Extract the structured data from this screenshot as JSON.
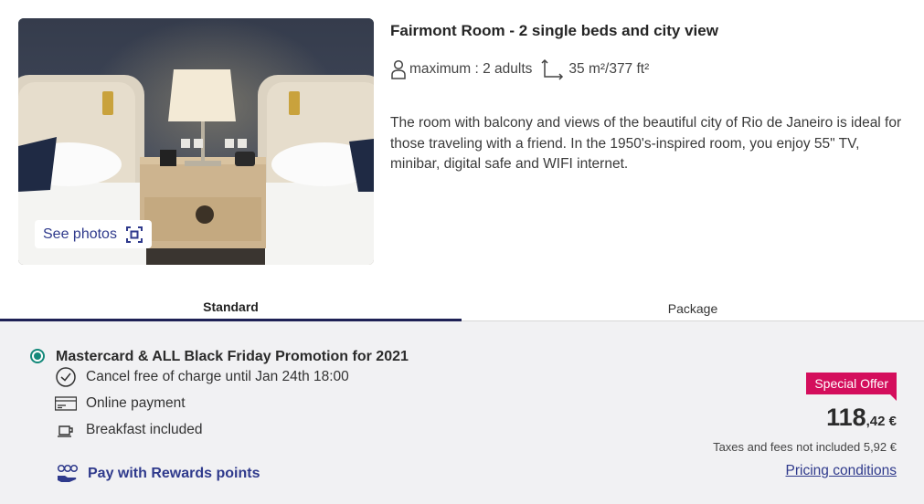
{
  "photo": {
    "see_photos_label": "See photos",
    "expand_icon": "expand-frame-icon"
  },
  "room": {
    "title": "Fairmont Room - 2 single beds and city view",
    "occupancy_icon": "person-icon",
    "occupancy": "maximum : 2 adults",
    "size_icon": "room-size-icon",
    "size": "35 m²/377 ft²",
    "description": "The room with balcony and views of the beautiful city of Rio de Janeiro is ideal for those traveling with a friend. In the 1950's-inspired room, you enjoy 55\" TV, minibar, digital safe and WIFI internet."
  },
  "tabs": [
    {
      "label": "Standard",
      "selected": true
    },
    {
      "label": "Package",
      "selected": false
    }
  ],
  "offer": {
    "name": "Mastercard & ALL Black Friday Promotion for 2021",
    "selected": true,
    "features": [
      {
        "icon": "clock-icon",
        "text": "Cancel free of charge until Jan 24th 18:00"
      },
      {
        "icon": "credit-card-icon",
        "text": "Online payment"
      },
      {
        "icon": "coffee-cup-icon",
        "text": "Breakfast included"
      }
    ],
    "rewards_icon": "rewards-points-icon",
    "rewards_label": "Pay with Rewards points",
    "badge": "Special Offer",
    "price_integer": "118",
    "price_decimal": ",42 €",
    "taxes": "Taxes and fees not included 5,92 €",
    "pricing_link": "Pricing conditions"
  },
  "colors": {
    "accent_blue": "#2f3a8c",
    "tab_underline": "#1e2155",
    "radio_teal": "#14897a",
    "badge_pink": "#d40e5c",
    "panel_bg": "#f1f1f3"
  }
}
